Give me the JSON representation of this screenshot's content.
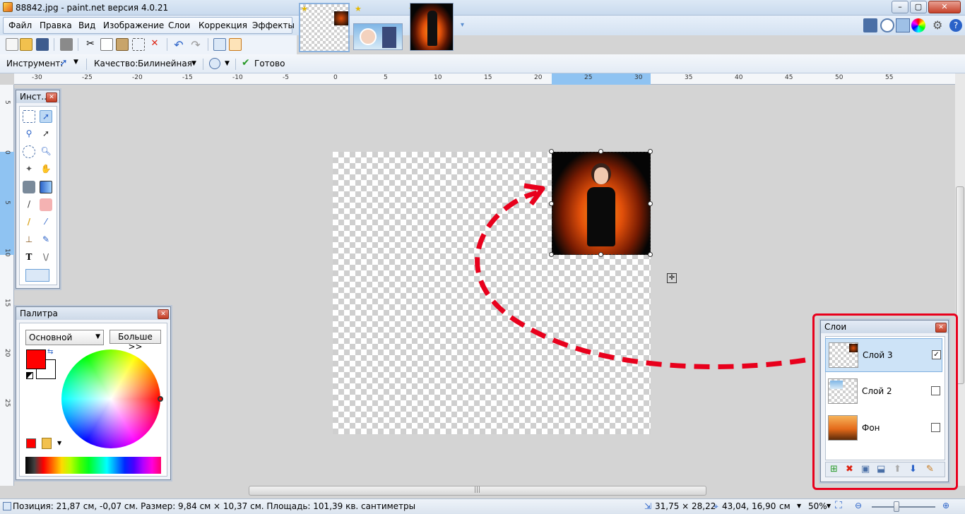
{
  "window": {
    "title": "88842.jpg - paint.net версия 4.0.21"
  },
  "menu": {
    "items": [
      "Файл",
      "Правка",
      "Вид",
      "Изображение",
      "Слои",
      "Коррекция",
      "Эффекты"
    ]
  },
  "toolbar2": {
    "tool_label": "Инструмент:",
    "quality_label": "Качество:",
    "quality_value": "Билинейная",
    "done_label": "Готово"
  },
  "ruler": {
    "h_ticks": [
      "-30",
      "-25",
      "-20",
      "-15",
      "-10",
      "-5",
      "0",
      "5",
      "10",
      "15",
      "20",
      "25",
      "30",
      "35",
      "40",
      "45",
      "50",
      "55"
    ],
    "v_ticks": [
      "5",
      "0",
      "5",
      "10",
      "15",
      "20",
      "25"
    ]
  },
  "tools_panel": {
    "title": "Инст..."
  },
  "palette_panel": {
    "title": "Палитра",
    "mode_value": "Основной",
    "more_button": "Больше >>",
    "primary_color": "#ff0000",
    "secondary_color": "#ffffff"
  },
  "layers_panel": {
    "title": "Слои",
    "layers": [
      {
        "name": "Слой 3",
        "checked": true,
        "selected": true
      },
      {
        "name": "Слой 2",
        "checked": false,
        "selected": false
      },
      {
        "name": "Фон",
        "checked": false,
        "selected": false
      }
    ]
  },
  "status": {
    "position_text": "Позиция: 21,87 см, -0,07 см. Размер: 9,84 см × 10,37 см. Площадь: 101,39 кв. сантиметры",
    "selection_size": "31,75 × 28,22",
    "cursor_pos": "43,04, 16,90",
    "unit": "см",
    "zoom": "50%"
  },
  "colors": {
    "accent": "#e8001c",
    "highlight": "#cde3f7"
  }
}
